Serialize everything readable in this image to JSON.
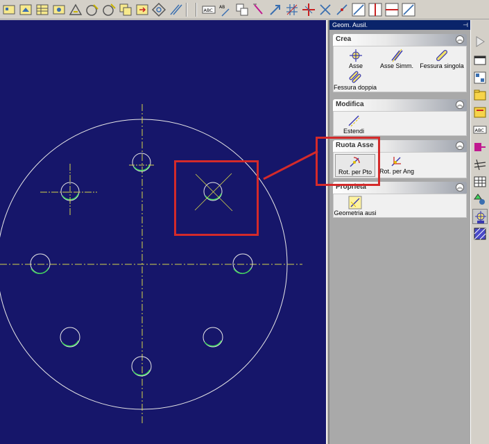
{
  "panel": {
    "title": "Geom. Ausil.",
    "pin_icon": "pin-icon",
    "groups": [
      {
        "title": "Crea",
        "tools": [
          {
            "label": "Asse",
            "icon": "axis-icon"
          },
          {
            "label": "Asse Simm.",
            "icon": "symmetry-axis-icon"
          },
          {
            "label": "Fessura singola",
            "icon": "single-slot-icon"
          },
          {
            "label": "Fessura doppia",
            "icon": "double-slot-icon"
          }
        ]
      },
      {
        "title": "Modifica",
        "tools": [
          {
            "label": "Estendi",
            "icon": "extend-icon"
          }
        ]
      },
      {
        "title": "Ruota Asse",
        "tools": [
          {
            "label": "Rot. per Pto",
            "icon": "rotate-by-point-icon"
          },
          {
            "label": "Rot. per Ang",
            "icon": "rotate-by-angle-icon"
          }
        ]
      },
      {
        "title": "Proprietà",
        "tools": [
          {
            "label": "Geometria ausi",
            "icon": "aux-geometry-icon"
          }
        ]
      }
    ]
  },
  "toolbar": {
    "icons": [
      "select-icon",
      "area-icon",
      "table-icon",
      "view-icon",
      "triangle-icon",
      "circle-tool-icon",
      "arc-tool-icon",
      "copy-icon",
      "move-icon",
      "center-icon",
      "parallel-icon",
      "text-icon",
      "dimension-icon",
      "hatch-icon",
      "pen-icon",
      "arrow-icon",
      "grid-icon",
      "cross-icon",
      "trim-icon",
      "diagonal-icon",
      "vertical-line-icon",
      "horizontal-line-icon",
      "diagonal-box-icon"
    ]
  },
  "colors": {
    "canvas": "#16166a",
    "geometry": "#e8e8e8",
    "axis": "#d6d64a",
    "hole_aux": "#3fd45b",
    "highlight": "#d42a2a"
  }
}
